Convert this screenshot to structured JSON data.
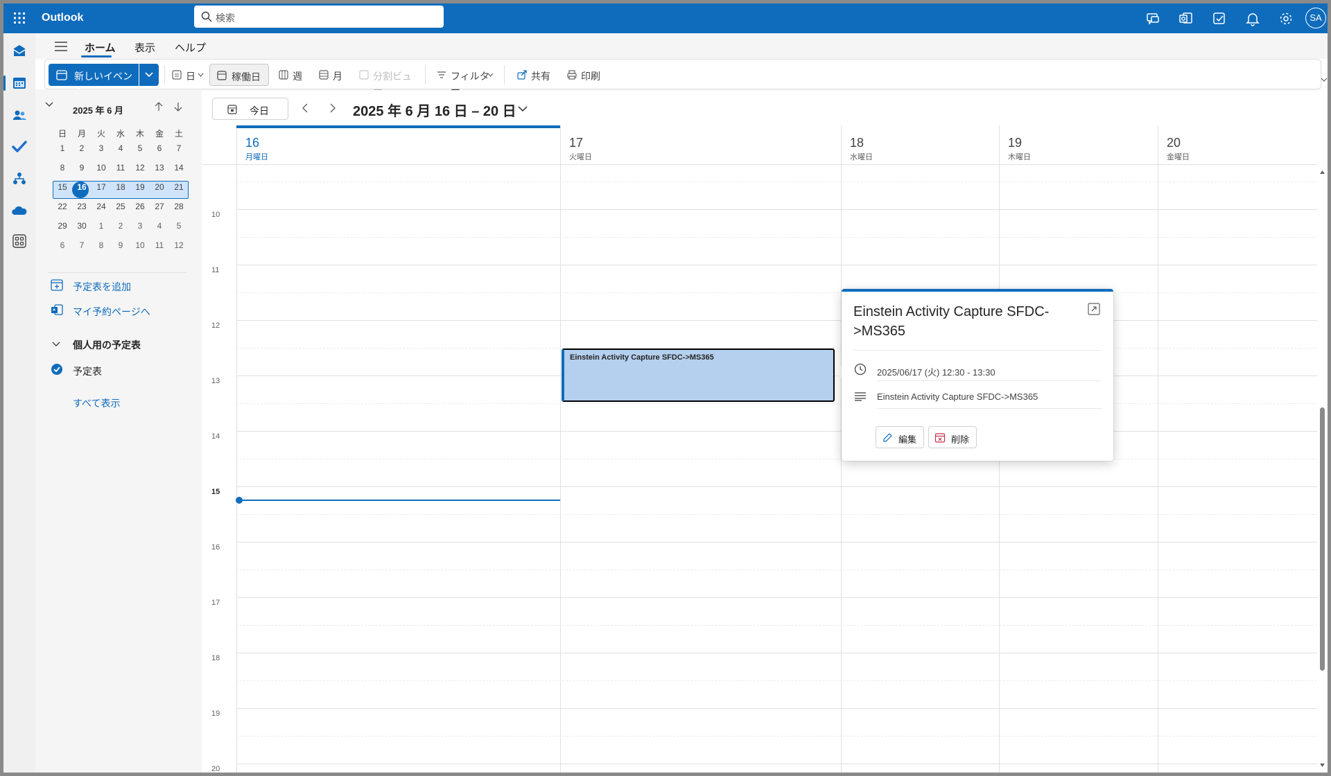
{
  "app": {
    "title": "Outlook"
  },
  "search": {
    "placeholder": "検索"
  },
  "topbar_icons": [
    "feedback-icon",
    "outlook-app-icon",
    "todo-icon",
    "bell-icon",
    "gear-icon"
  ],
  "user": {
    "initials": "SA"
  },
  "tabs": [
    {
      "label": "ホーム",
      "active": true
    },
    {
      "label": "表示",
      "active": false
    },
    {
      "label": "ヘルプ",
      "active": false
    }
  ],
  "ribbon": {
    "new_event": "新しいイベント",
    "day": "日",
    "work_week": "稼働日",
    "week": "週",
    "month": "月",
    "split_view": "分割ビュー",
    "filter": "フィルター",
    "share": "共有",
    "print": "印刷"
  },
  "mini_calendar": {
    "title": "2025 年 6 月",
    "weekdays": [
      "日",
      "月",
      "火",
      "水",
      "木",
      "金",
      "土"
    ],
    "weeks": [
      [
        "1",
        "2",
        "3",
        "4",
        "5",
        "6",
        "7"
      ],
      [
        "8",
        "9",
        "10",
        "11",
        "12",
        "13",
        "14"
      ],
      [
        "15",
        "16",
        "17",
        "18",
        "19",
        "20",
        "21"
      ],
      [
        "22",
        "23",
        "24",
        "25",
        "26",
        "27",
        "28"
      ],
      [
        "29",
        "30",
        "1",
        "2",
        "3",
        "4",
        "5"
      ],
      [
        "6",
        "7",
        "8",
        "9",
        "10",
        "11",
        "12"
      ]
    ],
    "today": "16"
  },
  "left_pane": {
    "add_calendar": "予定表を追加",
    "booking_page": "マイ予約ページへ",
    "group_title": "個人用の予定表",
    "calendar_name": "予定表",
    "show_all": "すべて表示"
  },
  "nav": {
    "today": "今日",
    "range": "2025 年 6 月 16 日 – 20 日"
  },
  "days": [
    {
      "num": "16",
      "weekday": "月曜日",
      "today": true
    },
    {
      "num": "17",
      "weekday": "火曜日",
      "today": false
    },
    {
      "num": "18",
      "weekday": "水曜日",
      "today": false
    },
    {
      "num": "19",
      "weekday": "木曜日",
      "today": false
    },
    {
      "num": "20",
      "weekday": "金曜日",
      "today": false
    }
  ],
  "hours": [
    "10",
    "11",
    "12",
    "13",
    "14",
    "15",
    "16",
    "17",
    "18",
    "19",
    "20"
  ],
  "current_hour_label": "15",
  "event": {
    "title": "Einstein Activity Capture SFDC->MS365",
    "day": "17",
    "start": "12:30",
    "end": "13:30",
    "color": "#b4d0ee"
  },
  "popup": {
    "title": "Einstein Activity Capture SFDC->MS365",
    "time": "2025/06/17 (火) 12:30 - 13:30",
    "description": "Einstein Activity Capture SFDC->MS365",
    "edit": "編集",
    "delete": "削除"
  },
  "colors": {
    "accent": "#0f6cbd",
    "event_fill": "#b4d0ee",
    "delete_icon": "#c4314b"
  }
}
